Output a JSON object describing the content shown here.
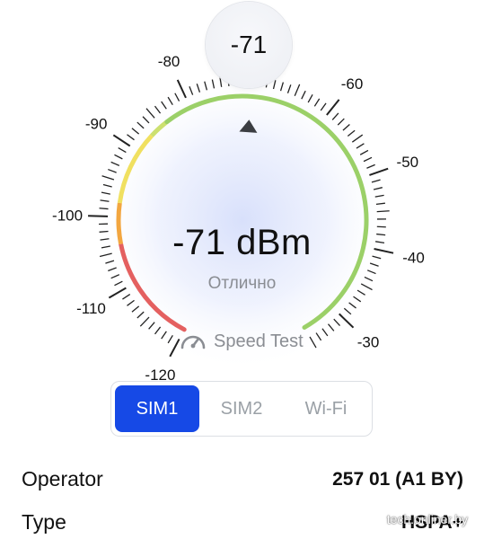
{
  "gauge": {
    "current_value": "-71",
    "reading": -71,
    "scale_min": -120,
    "scale_max": -25,
    "scale_labels": [
      "-120",
      "-110",
      "-100",
      "-90",
      "-80",
      "-60",
      "-50",
      "-40",
      "-30"
    ],
    "colors": {
      "red": "#e46060",
      "orange": "#f2a640",
      "yellow": "#f0e060",
      "green": "#9bd068",
      "pointer": "#3b3d42",
      "glow": "#dfe5fb"
    }
  },
  "signal": {
    "value_label": "-71 dBm",
    "quality_label": "Отлично"
  },
  "speed_test": {
    "label": "Speed Test",
    "icon": "speedometer-icon"
  },
  "tabs": [
    {
      "label": "SIM1",
      "active": true
    },
    {
      "label": "SIM2",
      "active": false
    },
    {
      "label": "Wi-Fi",
      "active": false
    }
  ],
  "info": {
    "operator_label": "Operator",
    "operator_value": "257 01 (A1 BY)",
    "type_label": "Type",
    "type_value": "HSPA+"
  },
  "watermark": "tech.onliner.by"
}
